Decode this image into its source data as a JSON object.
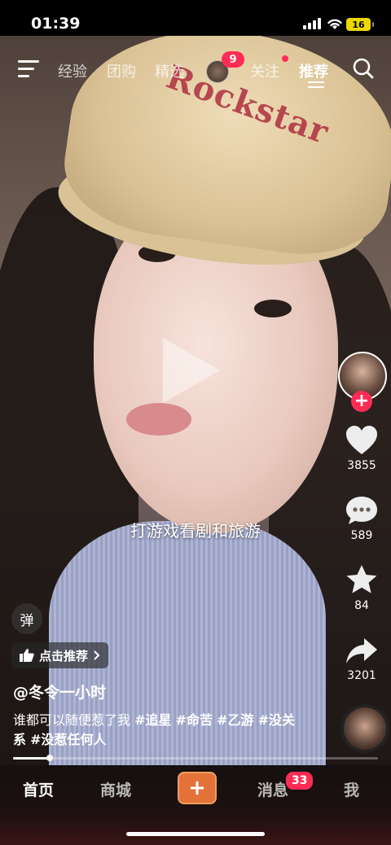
{
  "status_bar": {
    "time": "01:39",
    "battery": "16"
  },
  "top_nav": {
    "tabs": [
      "经验",
      "团购",
      "精选",
      "关注",
      "推荐"
    ],
    "active_tab": "推荐",
    "avatar_badge": "9"
  },
  "video": {
    "cap_text": "Rockstar",
    "subtitle": "打游戏看剧和旅游",
    "danmu_label": "弹",
    "recommend_chip": "点击推荐",
    "author": "@冬令一小时",
    "caption_text": "谁都可以随便惹了我 ",
    "hashtags": [
      "#追星",
      "#命苦",
      "#乙游",
      "#没关系",
      "#没惹任何人"
    ],
    "progress": 0.1
  },
  "right_rail": {
    "likes": "3855",
    "comments": "589",
    "favorites": "84",
    "shares": "3201"
  },
  "bottom_nav": {
    "tabs": [
      "首页",
      "商城",
      "消息",
      "我"
    ],
    "active_tab": "首页",
    "messages_badge": "33"
  },
  "colors": {
    "accent": "#fe2c55",
    "create_button": "#e2723a"
  }
}
